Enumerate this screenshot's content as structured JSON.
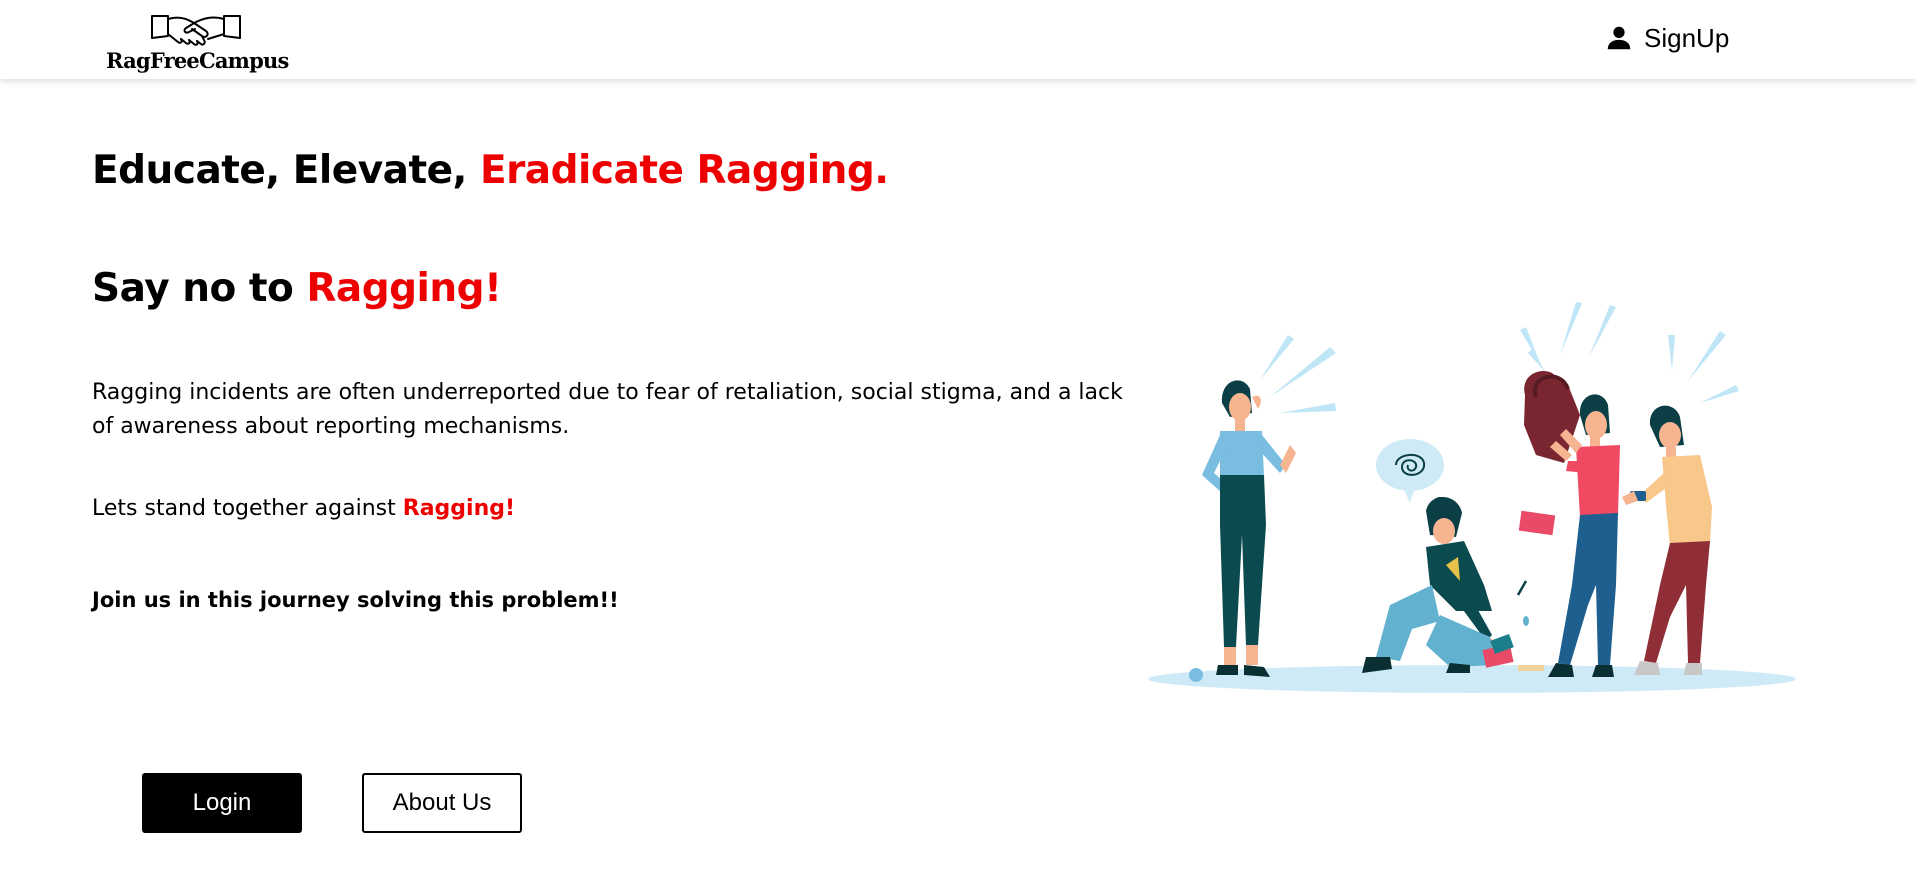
{
  "navbar": {
    "logo_text": "RagFreeCampus",
    "logo_icon": "handshake-icon",
    "signup_label": "SignUp",
    "signup_icon": "user-icon"
  },
  "hero": {
    "title_part1": "Educate, Elevate, ",
    "title_part2": "Eradicate Ragging.",
    "say_no_part1": "Say no to ",
    "say_no_part2": "Ragging!",
    "description": "Ragging incidents are often underreported due to fear of retaliation, social stigma, and a lack of awareness about reporting mechanisms.",
    "stand_text": "Lets stand together against ",
    "stand_highlight": "Ragging!",
    "join_text": "Join us in this journey solving this problem!!"
  },
  "buttons": {
    "login_label": "Login",
    "about_label": "About Us"
  },
  "colors": {
    "accent": "#ef0000",
    "login_bg": "#000000"
  }
}
